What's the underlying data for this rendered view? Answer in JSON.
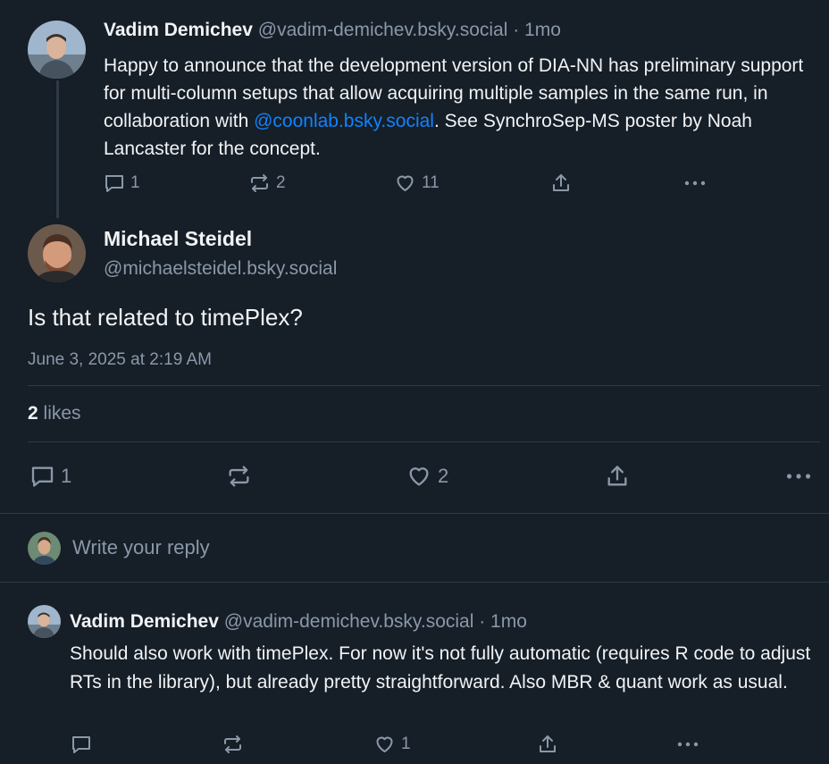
{
  "parent_post": {
    "author_name": "Vadim Demichev",
    "handle": "@vadim-demichev.bsky.social",
    "time": "· 1mo",
    "text_before": "Happy to announce that the development version of DIA-NN has preliminary support for multi-column setups that allow acquiring multiple samples in the same run, in collaboration with ",
    "mention": "@coonlab.bsky.social",
    "text_after": ". See SynchroSep-MS poster by Noah Lancaster for the concept.",
    "reply_count": "1",
    "repost_count": "2",
    "like_count": "11"
  },
  "focused_post": {
    "author_name": "Michael Steidel",
    "handle": "@michaelsteidel.bsky.social",
    "text": "Is that related to timePlex?",
    "timestamp": "June 3, 2025 at 2:19 AM",
    "likes_number": "2",
    "likes_label": " likes",
    "reply_count": "1",
    "like_count": "2"
  },
  "composer": {
    "placeholder": "Write your reply"
  },
  "reply_post": {
    "author_name": "Vadim Demichev",
    "handle": "@vadim-demichev.bsky.social",
    "time": "· 1mo",
    "text": "Should also work with timePlex. For now it's not fully automatic (requires R code to adjust RTs in the library), but already pretty straightforward. Also MBR & quant work as usual.",
    "like_count": "1"
  },
  "icons": {
    "reply": "reply-bubble-icon",
    "repost": "repost-arrows-icon",
    "like": "heart-icon",
    "share": "share-upload-icon",
    "more": "more-dots-icon"
  },
  "colors": {
    "background": "#161e27",
    "text": "#f1f3f5",
    "muted": "#8a98a9",
    "link": "#1083fe",
    "divider": "#2e3a48"
  }
}
